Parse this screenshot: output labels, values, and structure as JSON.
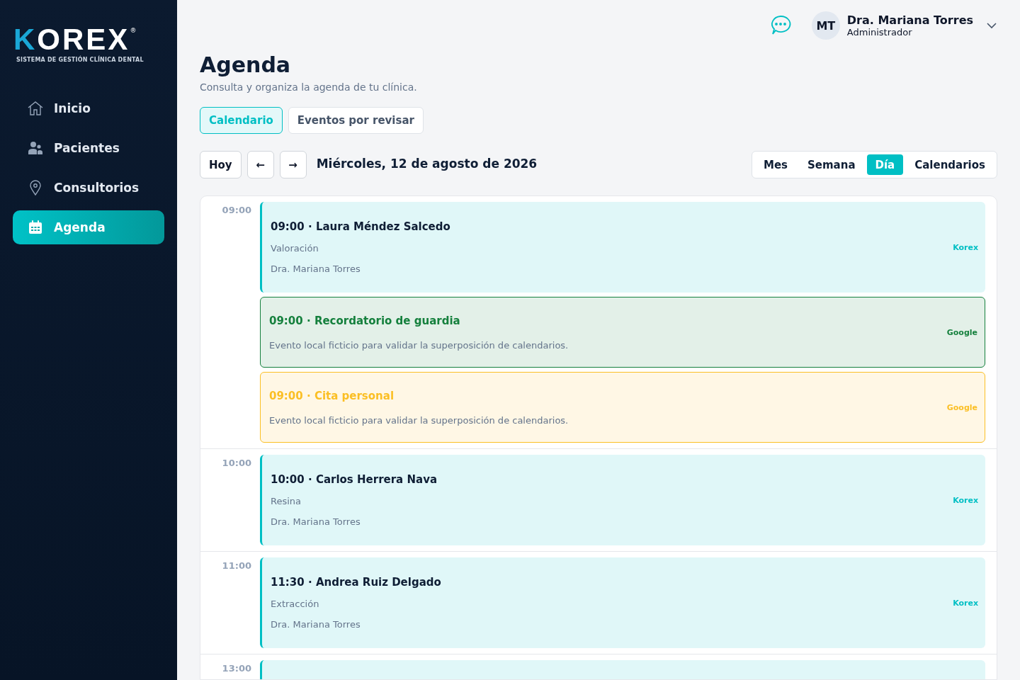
{
  "sidebar": {
    "logo": {
      "wordmark": "KOREX",
      "registered": "®",
      "tagline": "SISTEMA DE GESTIÓN CLÍNICA DENTAL"
    },
    "items": [
      {
        "label": "Inicio",
        "kind": "home",
        "selected": false
      },
      {
        "label": "Pacientes",
        "kind": "users",
        "selected": false
      },
      {
        "label": "Consultorios",
        "kind": "location",
        "selected": false
      },
      {
        "label": "Agenda",
        "kind": "calendar",
        "selected": true
      }
    ]
  },
  "header": {
    "user": {
      "initials": "MT",
      "name": "Dra. Mariana Torres",
      "role": "Administrador"
    }
  },
  "page": {
    "title": "Agenda",
    "subtitle": "Consulta y organiza la agenda de tu clínica."
  },
  "tabs": [
    {
      "label": "Calendario",
      "selected": true
    },
    {
      "label": "Eventos por revisar",
      "selected": false
    }
  ],
  "toolbar": {
    "today": "Hoy",
    "prev": "←",
    "next": "→",
    "date": "Miércoles, 12 de agosto de 2026",
    "views": [
      {
        "label": "Mes",
        "selected": false
      },
      {
        "label": "Semana",
        "selected": false
      },
      {
        "label": "Día",
        "selected": true
      },
      {
        "label": "Calendarios",
        "selected": false
      }
    ]
  },
  "slots": [
    {
      "time": "09:00",
      "events": [
        {
          "kind": "appointment",
          "color": "#00bfc4",
          "title": "09:00 · Laura Méndez Salcedo",
          "type": "Valoración",
          "doctor": "Dra. Mariana Torres",
          "source": "Korex"
        },
        {
          "kind": "external",
          "color": "#15803d",
          "title": "09:00 · Recordatorio de guardia",
          "description": "Evento local ficticio para validar la superposición de calendarios.",
          "source": "Google"
        },
        {
          "kind": "external",
          "color": "#fbbf24",
          "title": "09:00 · Cita personal",
          "description": "Evento local ficticio para validar la superposición de calendarios.",
          "source": "Google"
        }
      ]
    },
    {
      "time": "10:00",
      "events": [
        {
          "kind": "appointment",
          "color": "#00bfc4",
          "title": "10:00 · Carlos Herrera Nava",
          "type": "Resina",
          "doctor": "Dra. Mariana Torres",
          "source": "Korex"
        }
      ]
    },
    {
      "time": "11:00",
      "events": [
        {
          "kind": "appointment",
          "color": "#00bfc4",
          "title": "11:30 · Andrea Ruiz Delgado",
          "type": "Extracción",
          "doctor": "Dra. Mariana Torres",
          "source": "Korex"
        }
      ]
    },
    {
      "time": "13:00",
      "events": [
        {
          "kind": "appointment",
          "color": "#00bfc4"
        }
      ]
    }
  ]
}
